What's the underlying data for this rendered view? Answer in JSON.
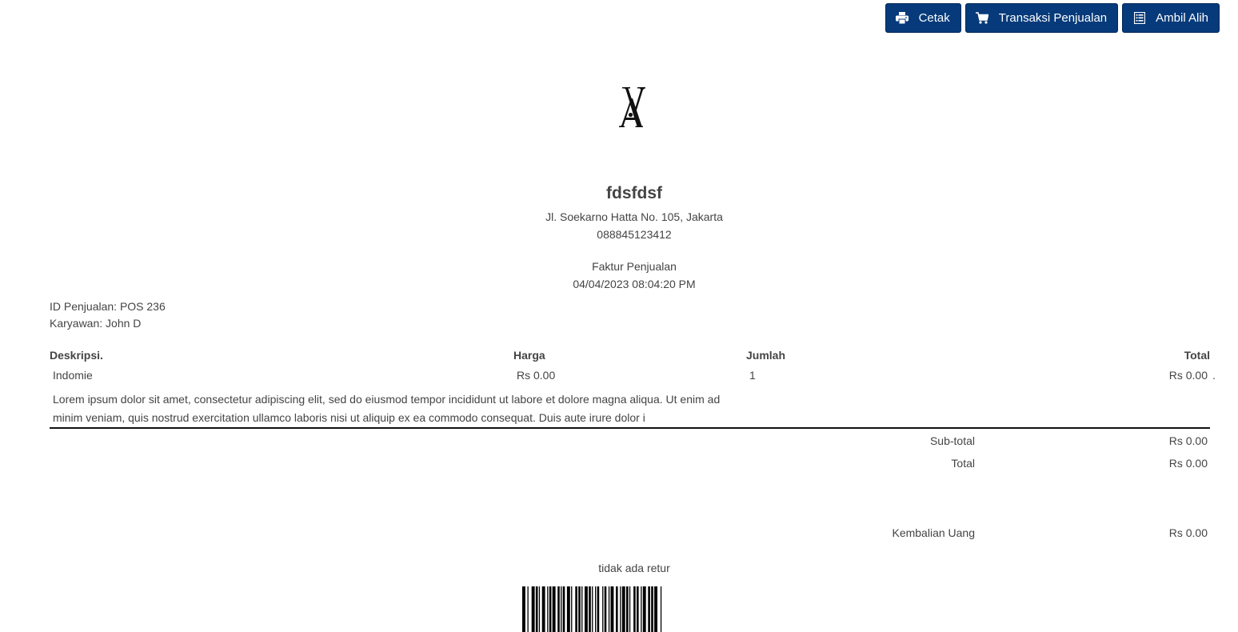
{
  "toolbar": {
    "print_label": "Cetak",
    "sales_label": "Transaksi Penjualan",
    "takeover_label": "Ambil Alih",
    "accent": "#063a7a"
  },
  "store": {
    "name": "fdsfdsf",
    "address": "Jl. Soekarno Hatta No. 105, Jakarta",
    "phone": "088845123412"
  },
  "invoice": {
    "title": "Faktur Penjualan",
    "datetime": "04/04/2023 08:04:20 PM",
    "sale_id": "ID Penjualan: POS 236",
    "employee": "Karyawan: John D"
  },
  "table": {
    "headers": {
      "description": "Deskripsi.",
      "price": "Harga",
      "quantity": "Jumlah",
      "total": "Total"
    },
    "rows": [
      {
        "description": "Indomie",
        "price": "Rs 0.00",
        "quantity": "1",
        "total": "Rs 0.00",
        "trailing_mark": ".",
        "note": "Lorem ipsum dolor sit amet, consectetur adipiscing elit, sed do eiusmod tempor incididunt ut labore et dolore magna aliqua. Ut enim ad minim veniam, quis nostrud exercitation ullamco laboris nisi ut aliquip ex ea commodo consequat. Duis aute irure dolor i"
      }
    ]
  },
  "summary": {
    "subtotal_label": "Sub-total",
    "subtotal_value": "Rs 0.00",
    "total_label": "Total",
    "total_value": "Rs 0.00",
    "change_label": "Kembalian Uang",
    "change_value": "Rs 0.00"
  },
  "footer": {
    "return_note": "tidak ada retur"
  },
  "icons": {
    "print": "printer-icon",
    "sales": "cart-icon",
    "takeover": "list-icon"
  }
}
